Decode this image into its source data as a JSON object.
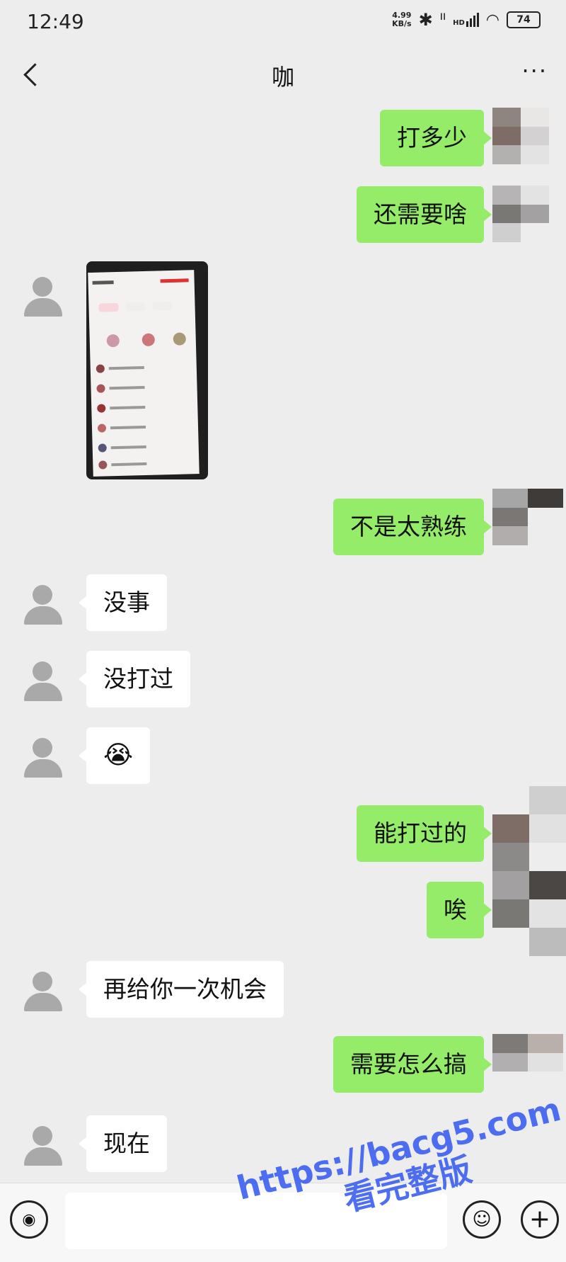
{
  "status_bar": {
    "time": "12:49",
    "net_speed": "4.99",
    "net_unit": "KB/s",
    "hd": "HD",
    "battery": "74"
  },
  "nav": {
    "title": "咖",
    "more": "···"
  },
  "messages": [
    {
      "side": "me",
      "text": "打多少"
    },
    {
      "side": "me",
      "text": "还需要啥"
    },
    {
      "side": "other",
      "type": "image"
    },
    {
      "side": "me",
      "text": "不是太熟练"
    },
    {
      "side": "other",
      "text": "没事"
    },
    {
      "side": "other",
      "text": "没打过"
    },
    {
      "side": "other",
      "text": "😭"
    },
    {
      "side": "me",
      "text": "能打过的"
    },
    {
      "side": "me",
      "text": "唉"
    },
    {
      "side": "other",
      "text": "再给你一次机会"
    },
    {
      "side": "me",
      "text": "需要怎么搞"
    },
    {
      "side": "other",
      "text": "现在"
    }
  ],
  "input": {
    "value": "",
    "placeholder": ""
  },
  "watermark": {
    "line1": "https://bacg5.com",
    "line2": "看完整版"
  },
  "colors": {
    "my_bubble": "#95ec69",
    "other_bubble": "#ffffff",
    "background": "#ededed"
  }
}
